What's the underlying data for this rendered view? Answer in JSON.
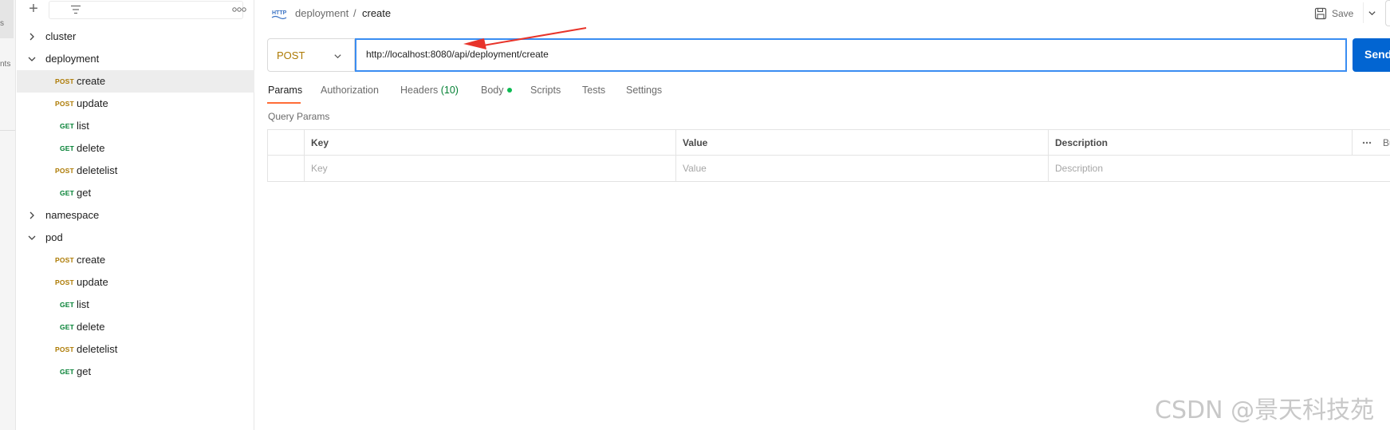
{
  "rail": {
    "label_top": "s",
    "label_mid": "nts"
  },
  "sidebar": {
    "items": [
      {
        "type": "folder",
        "label": "cluster",
        "expanded": false
      },
      {
        "type": "folder",
        "label": "deployment",
        "expanded": true
      },
      {
        "type": "request",
        "method": "POST",
        "label": "create",
        "selected": true
      },
      {
        "type": "request",
        "method": "POST",
        "label": "update"
      },
      {
        "type": "request",
        "method": "GET",
        "label": "list"
      },
      {
        "type": "request",
        "method": "GET",
        "label": "delete"
      },
      {
        "type": "request",
        "method": "POST",
        "label": "deletelist"
      },
      {
        "type": "request",
        "method": "GET",
        "label": "get"
      },
      {
        "type": "folder",
        "label": "namespace",
        "expanded": false
      },
      {
        "type": "folder",
        "label": "pod",
        "expanded": true
      },
      {
        "type": "request",
        "method": "POST",
        "label": "create"
      },
      {
        "type": "request",
        "method": "POST",
        "label": "update"
      },
      {
        "type": "request",
        "method": "GET",
        "label": "list"
      },
      {
        "type": "request",
        "method": "GET",
        "label": "delete"
      },
      {
        "type": "request",
        "method": "POST",
        "label": "deletelist"
      },
      {
        "type": "request",
        "method": "GET",
        "label": "get"
      }
    ]
  },
  "header": {
    "breadcrumb_parent": "deployment",
    "breadcrumb_sep": "/",
    "breadcrumb_current": "create",
    "save_label": "Save"
  },
  "request": {
    "method": "POST",
    "url": "http://localhost:8080/api/deployment/create",
    "send_label": "Send"
  },
  "tabs": {
    "params": "Params",
    "authorization": "Authorization",
    "headers": "Headers",
    "headers_count": "(10)",
    "body": "Body",
    "scripts": "Scripts",
    "tests": "Tests",
    "settings": "Settings"
  },
  "query_params": {
    "title": "Query Params",
    "headers": {
      "key": "Key",
      "value": "Value",
      "description": "Description",
      "bulk": "Bu"
    },
    "placeholders": {
      "key": "Key",
      "value": "Value",
      "description": "Description"
    }
  },
  "colors": {
    "post": "#ad7a03",
    "get": "#007f31",
    "accent": "#ff6c37",
    "send": "#0265d2",
    "url_focus": "#3a8df2",
    "annotation_arrow": "#e8342a"
  },
  "watermark": "CSDN @景天科技苑"
}
